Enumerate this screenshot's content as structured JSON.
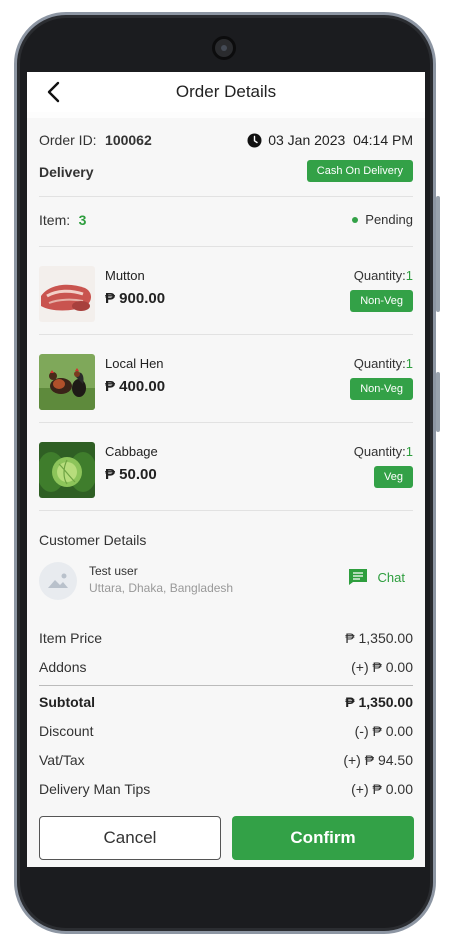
{
  "header": {
    "title": "Order Details"
  },
  "order": {
    "id_label": "Order ID:",
    "id_value": "100062",
    "datetime": "03 Jan 2023  04:14 PM",
    "type": "Delivery",
    "payment_badge": "Cash On Delivery",
    "item_label": "Item:",
    "item_count": "3",
    "status": "Pending"
  },
  "items": [
    {
      "name": "Mutton",
      "price": "₱ 900.00",
      "qty_label": "Quantity:",
      "qty": "1",
      "tag": "Non-Veg"
    },
    {
      "name": "Local Hen",
      "price": "₱ 400.00",
      "qty_label": "Quantity:",
      "qty": "1",
      "tag": "Non-Veg"
    },
    {
      "name": "Cabbage",
      "price": "₱ 50.00",
      "qty_label": "Quantity:",
      "qty": "1",
      "tag": "Veg"
    }
  ],
  "customer": {
    "section_title": "Customer Details",
    "name": "Test user",
    "address": "Uttara, Dhaka, Bangladesh",
    "chat_label": "Chat"
  },
  "summary": {
    "item_price_label": "Item Price",
    "item_price": "₱ 1,350.00",
    "addons_label": "Addons",
    "addons": "(+) ₱ 0.00",
    "subtotal_label": "Subtotal",
    "subtotal": "₱ 1,350.00",
    "discount_label": "Discount",
    "discount": "(-) ₱ 0.00",
    "vat_label": "Vat/Tax",
    "vat": "(+) ₱ 94.50",
    "tips_label": "Delivery Man Tips",
    "tips": "(+) ₱ 0.00"
  },
  "actions": {
    "cancel": "Cancel",
    "confirm": "Confirm"
  },
  "colors": {
    "accent": "#33a147",
    "status_dot": "#33a147"
  }
}
